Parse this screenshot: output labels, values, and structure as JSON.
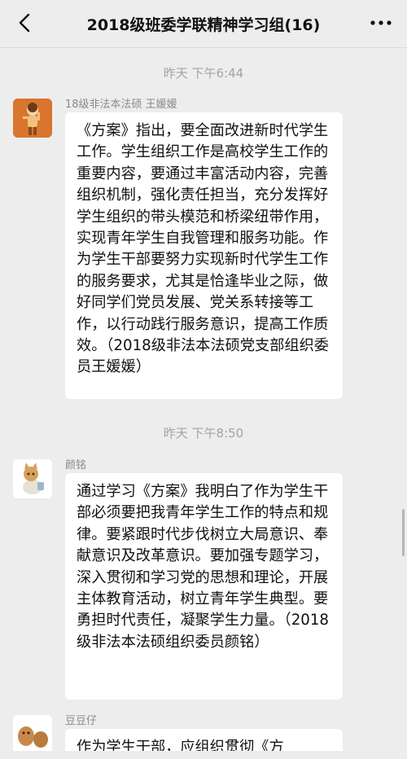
{
  "header": {
    "title": "2018级班委学联精神学习组(16)",
    "back_icon": "chevron-left-icon",
    "more_icon": "more-dots-icon"
  },
  "timestamps": [
    "昨天 下午6:44",
    "昨天 下午8:50"
  ],
  "messages": [
    {
      "sender": "18级非法本法硕 王媛媛",
      "text": "《方案》指出，要全面改进新时代学生工作。学生组织工作是高校学生工作的重要内容，要通过丰富活动内容，完善组织机制，强化责任担当，充分发挥好学生组织的带头模范和桥梁纽带作用，实现青年学生自我管理和服务功能。作为学生干部要努力实现新时代学生工作的服务要求，尤其是恰逢毕业之际，做好同学们党员发展、党关系转接等工作，以行动践行服务意识，提高工作质效。（2018级非法本法硕党支部组织委员王媛媛）"
    },
    {
      "sender": "颜铭",
      "text": "通过学习《方案》我明白了作为学生干部必须要把我青年学生工作的特点和规律。要紧跟时代步伐树立大局意识、奉献意识及改革意识。要加强专题学习，深入贯彻和学习党的思想和理论，开展主体教育活动，树立青年学生典型。要勇担时代责任，凝聚学生力量。（2018级非法本法硕组织委员颜铭）"
    },
    {
      "sender": "豆豆仔",
      "text": "作为学生干部，应组织贯彻《方"
    }
  ],
  "colors": {
    "background": "#ededed",
    "bubble": "#ffffff",
    "timestamp": "#a3a3a3",
    "sender": "#8a8a8a"
  }
}
